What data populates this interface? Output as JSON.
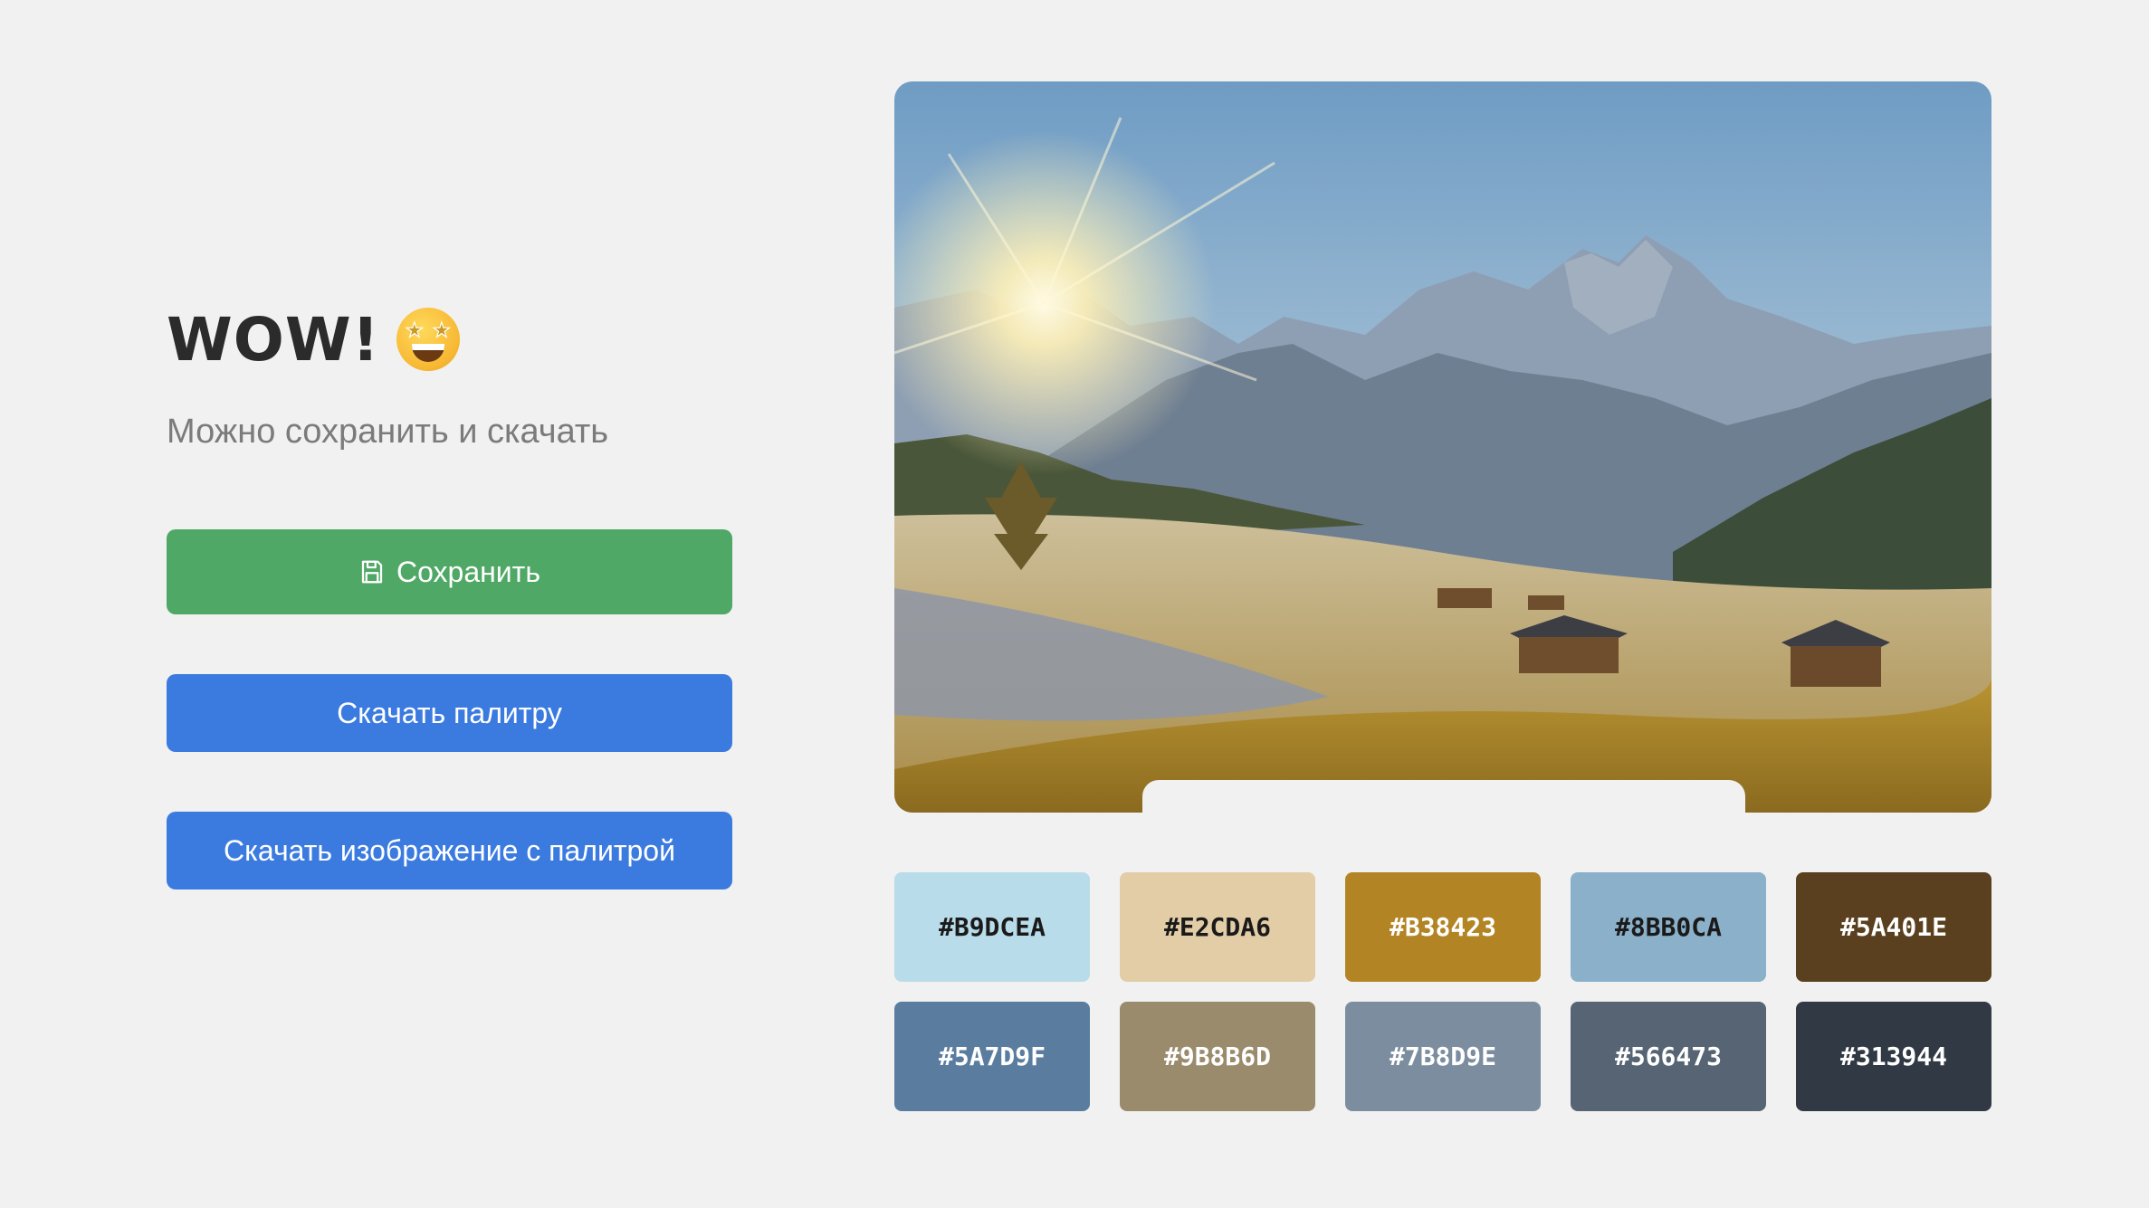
{
  "header": {
    "title": "WOW!",
    "emoji": "star-struck-emoji"
  },
  "subtitle": "Можно сохранить и скачать",
  "buttons": {
    "save": "Сохранить",
    "download_palette": "Скачать палитру",
    "download_image": "Скачать изображение с палитрой"
  },
  "photo": {
    "subject": "mountain-landscape-photo"
  },
  "palette": [
    {
      "hex": "#B9DCEA",
      "text": "#1a1a1a"
    },
    {
      "hex": "#E2CDA6",
      "text": "#1a1a1a"
    },
    {
      "hex": "#B38423",
      "text": "#ffffff"
    },
    {
      "hex": "#8BB0CA",
      "text": "#1a1a1a"
    },
    {
      "hex": "#5A401E",
      "text": "#ffffff"
    },
    {
      "hex": "#5A7D9F",
      "text": "#ffffff"
    },
    {
      "hex": "#9B8B6D",
      "text": "#ffffff"
    },
    {
      "hex": "#7B8D9E",
      "text": "#ffffff"
    },
    {
      "hex": "#566473",
      "text": "#ffffff"
    },
    {
      "hex": "#313944",
      "text": "#ffffff"
    }
  ],
  "colors": {
    "green": "#4fa865",
    "blue": "#3b7be0",
    "background": "#f1f1f1"
  }
}
